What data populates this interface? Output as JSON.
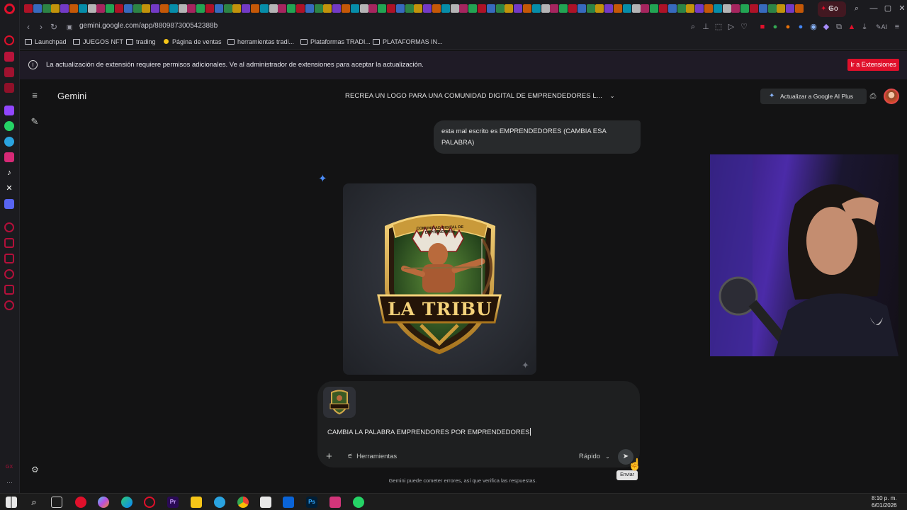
{
  "browser": {
    "active_tab_label": "Go",
    "url": "gemini.google.com/app/880987300542388b",
    "bookmarks": [
      "Launchpad",
      "JUEGOS NFT",
      "trading",
      "Página de ventas",
      "herramientas tradi...",
      "Plataformas TRADI...",
      "PLATAFORMAS IN..."
    ],
    "notice": {
      "text": "La actualización de extensión requiere permisos adicionales. Ve al administrador de extensiones para aceptar la actualización.",
      "button": "Ir a Extensiones"
    },
    "sidebar_badge": "GX",
    "addr_ai_label": "AI"
  },
  "gemini": {
    "app_title": "Gemini",
    "chat_title": "RECREA UN LOGO PARA UNA COMUNIDAD DIGITAL DE EMPRENDEDORES L...",
    "upgrade_label": "Actualizar a Google AI Plus",
    "user_message": "esta mal escrito es EMPRENDEDORES (CAMBIA ESA PALABRA)",
    "logo": {
      "banner_text": "COMUNIDAD DIGITAL DE EMPRENDORES",
      "main_text": "LA TRIBU"
    },
    "composer": {
      "text": "CAMBIA LA PALABRA EMPRENDORES POR EMPRENDEDORES",
      "tools_label": "Herramientas",
      "mode_label": "Rápido",
      "send_tooltip": "Enviar"
    },
    "disclaimer": "Gemini puede cometer errores, así que verifica las respuestas."
  },
  "taskbar": {
    "time": "8:10 p. m.",
    "date": "6/01/2026"
  },
  "colors": {
    "accent": "#e0102b",
    "gemini_bg": "#131314",
    "bubble_bg": "#282a2c",
    "composer_bg": "#1e1f20"
  }
}
